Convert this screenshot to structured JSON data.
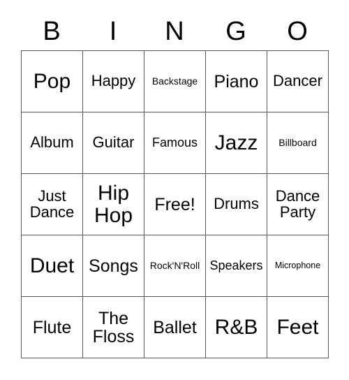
{
  "card": {
    "header_letters": [
      "B",
      "I",
      "N",
      "G",
      "O"
    ],
    "rows": [
      [
        {
          "label": "Pop",
          "size": "fs-xl"
        },
        {
          "label": "Happy",
          "size": "fs-md"
        },
        {
          "label": "Backstage",
          "size": "fs-xs"
        },
        {
          "label": "Piano",
          "size": "fs-lg"
        },
        {
          "label": "Dancer",
          "size": "fs-md"
        }
      ],
      [
        {
          "label": "Album",
          "size": "fs-md"
        },
        {
          "label": "Guitar",
          "size": "fs-md"
        },
        {
          "label": "Famous",
          "size": "fs-sm"
        },
        {
          "label": "Jazz",
          "size": "fs-xl"
        },
        {
          "label": "Billboard",
          "size": "fs-xs"
        }
      ],
      [
        {
          "label": "Just Dance",
          "size": "fs-md"
        },
        {
          "label": "Hip Hop",
          "size": "fs-xl"
        },
        {
          "label": "Free!",
          "size": "fs-lg"
        },
        {
          "label": "Drums",
          "size": "fs-md"
        },
        {
          "label": "Dance Party",
          "size": "fs-md"
        }
      ],
      [
        {
          "label": "Duet",
          "size": "fs-xl"
        },
        {
          "label": "Songs",
          "size": "fs-lg"
        },
        {
          "label": "Rock'N'Roll",
          "size": "fs-xs"
        },
        {
          "label": "Speakers",
          "size": "fs-sm"
        },
        {
          "label": "Microphone",
          "size": "fs-xxs"
        }
      ],
      [
        {
          "label": "Flute",
          "size": "fs-lg"
        },
        {
          "label": "The Floss",
          "size": "fs-lg"
        },
        {
          "label": "Ballet",
          "size": "fs-lg"
        },
        {
          "label": "R&B",
          "size": "fs-xl"
        },
        {
          "label": "Feet",
          "size": "fs-xl"
        }
      ]
    ]
  },
  "colors": {
    "grid_line": "#555555",
    "text": "#000000",
    "background": "#ffffff"
  }
}
